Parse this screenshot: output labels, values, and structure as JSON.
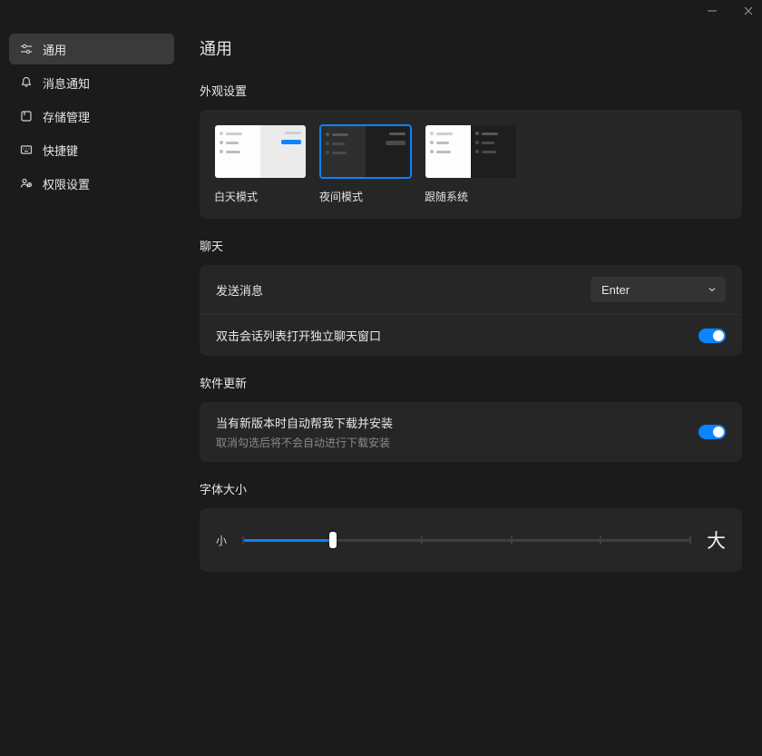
{
  "titlebar": {
    "minimize": "minimize",
    "close": "close"
  },
  "sidebar": {
    "items": [
      {
        "label": "通用",
        "icon": "sliders"
      },
      {
        "label": "消息通知",
        "icon": "bell"
      },
      {
        "label": "存储管理",
        "icon": "storage"
      },
      {
        "label": "快捷键",
        "icon": "keyboard"
      },
      {
        "label": "权限设置",
        "icon": "permissions"
      }
    ]
  },
  "main": {
    "title": "通用",
    "appearance": {
      "section_title": "外观设置",
      "options": [
        {
          "label": "白天模式"
        },
        {
          "label": "夜间模式"
        },
        {
          "label": "跟随系统"
        }
      ]
    },
    "chat": {
      "section_title": "聊天",
      "send_label": "发送消息",
      "send_value": "Enter",
      "dblclick_label": "双击会话列表打开独立聊天窗口"
    },
    "update": {
      "section_title": "软件更新",
      "row_label": "当有新版本时自动帮我下载并安装",
      "row_sub": "取消勾选后将不会自动进行下载安装"
    },
    "font": {
      "section_title": "字体大小",
      "small_label": "小",
      "large_label": "大",
      "value_percent": 20,
      "ticks": [
        0,
        20,
        40,
        60,
        80,
        100
      ]
    }
  }
}
